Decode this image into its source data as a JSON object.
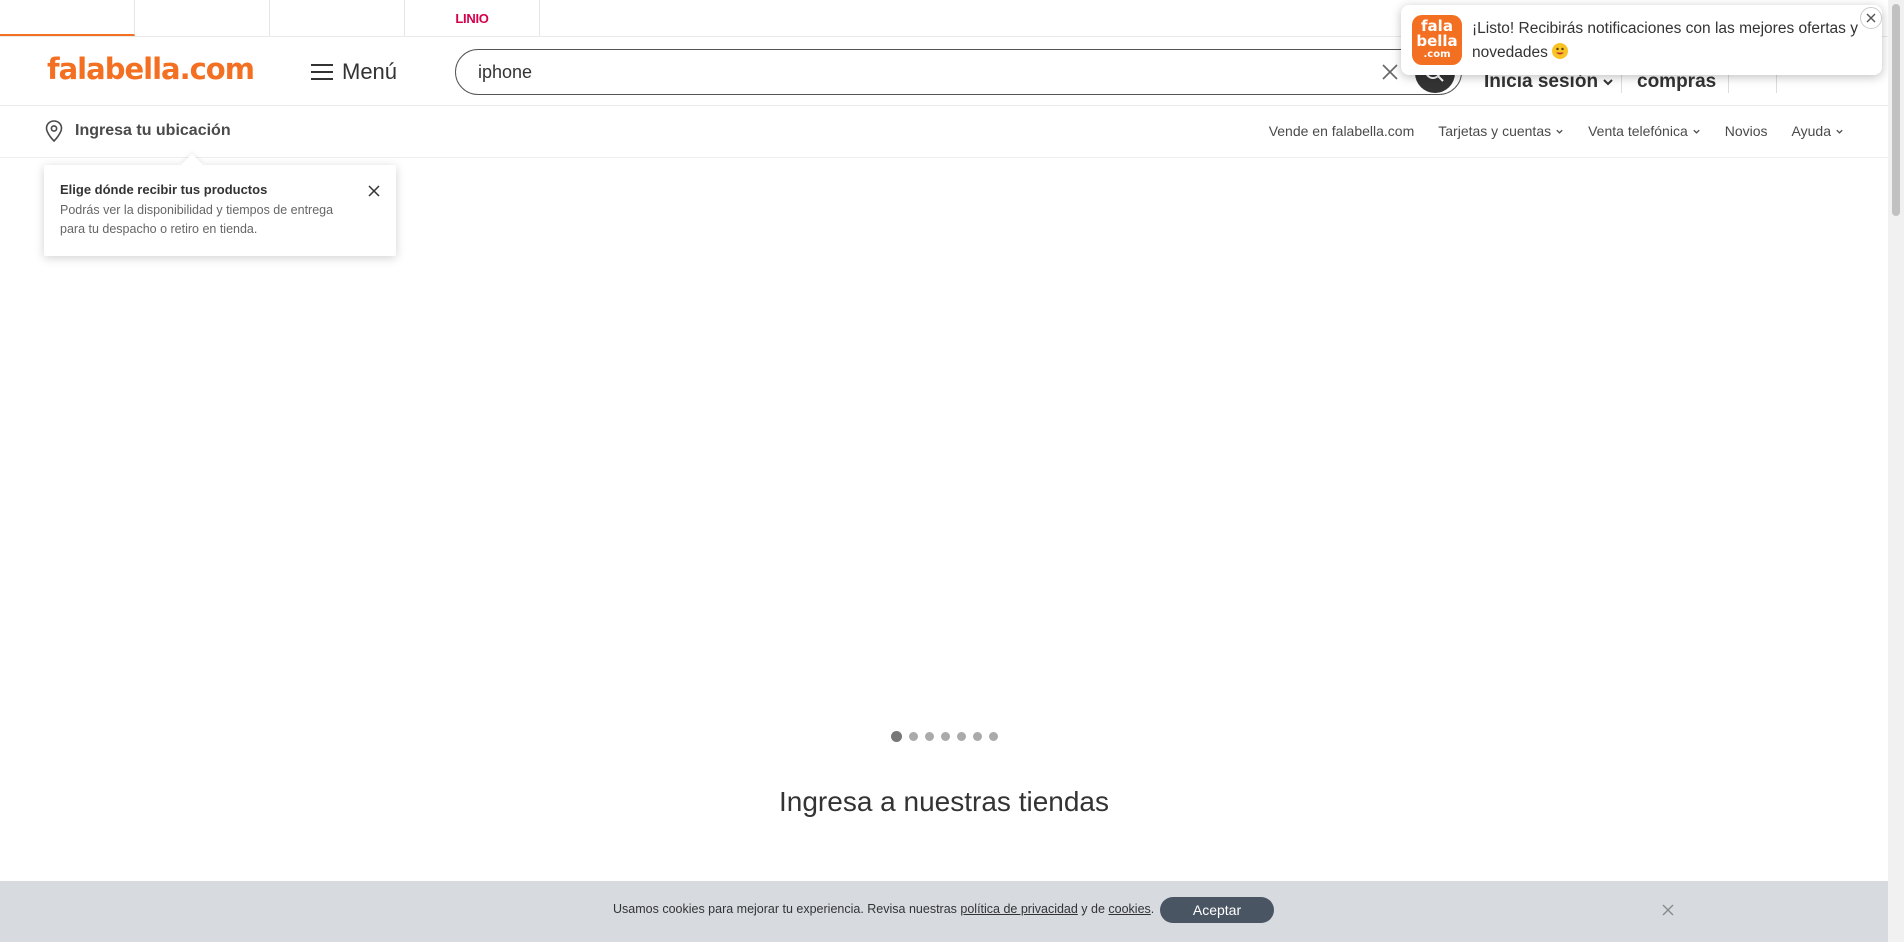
{
  "brand_tabs": [
    {
      "label": ""
    },
    {
      "label": ""
    },
    {
      "label": ""
    },
    {
      "label": "LINIO"
    }
  ],
  "header": {
    "logo_text": "falabella.com",
    "menu_label": "Menú",
    "search_value": "iphone",
    "login_label": "Inicia sesión",
    "purchases_label": "compras"
  },
  "subheader": {
    "location_label": "Ingresa tu ubicación",
    "links": [
      {
        "label": "Vende en falabella.com"
      },
      {
        "label": "Tarjetas y cuentas"
      },
      {
        "label": "Venta telefónica"
      },
      {
        "label": "Novios"
      },
      {
        "label": "Ayuda"
      }
    ]
  },
  "location_tooltip": {
    "title": "Elige dónde recibir tus productos",
    "body": "Podrás ver la disponibilidad y tiempos de entrega para tu despacho o retiro en tienda."
  },
  "carousel": {
    "dot_count": 7,
    "active_index": 0
  },
  "stores_title": "Ingresa a nuestras tiendas",
  "cookie": {
    "text_before": "Usamos cookies para mejorar tu experiencia. Revisa nuestras ",
    "privacy_link": "política de privacidad",
    "text_middle": " y de ",
    "cookies_link": "cookies",
    "text_end": ".",
    "accept_label": "Aceptar"
  },
  "notification": {
    "logo_line1": "fala",
    "logo_line2": "bella",
    "logo_line3": ".com",
    "message": "¡Listo! Recibirás notificaciones con las mejores ofertas y novedades"
  },
  "colors": {
    "brand": "#f36f21",
    "dark": "#333333",
    "cookie_bg": "#d7dbe0",
    "accept_bg": "#4a5563"
  }
}
